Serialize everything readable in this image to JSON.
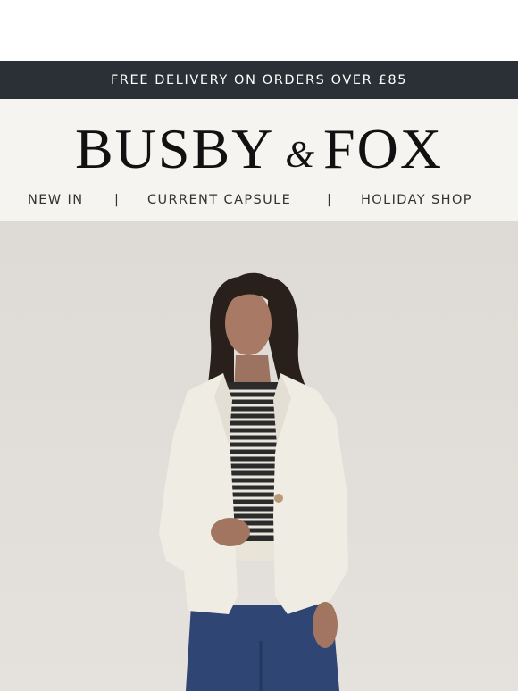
{
  "promo": {
    "text": "FREE DELIVERY ON ORDERS OVER £85"
  },
  "brand": {
    "left": "BUSBY",
    "amp": "&",
    "right": "FOX"
  },
  "nav": {
    "items": [
      "NEW IN",
      "CURRENT CAPSULE",
      "HOLIDAY SHOP"
    ],
    "separator": "|"
  },
  "hero": {
    "image": "model-in-cream-blazer-striped-top-and-jeans"
  },
  "colors": {
    "promo_bg": "#2a3035",
    "header_bg": "#f5f4f1",
    "hero_bg": "#dedad5"
  }
}
